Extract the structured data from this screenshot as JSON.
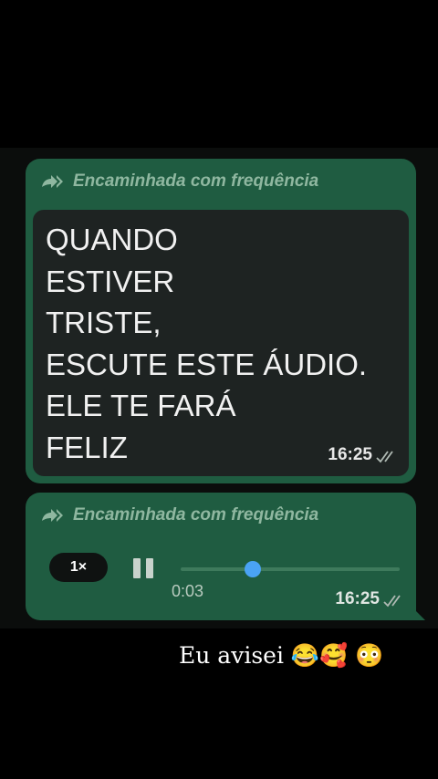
{
  "message_image": {
    "forwarded_label": "Encaminhada com frequência",
    "text_lines": [
      "QUANDO",
      "ESTIVER",
      "TRISTE,",
      "ESCUTE ESTE ÁUDIO.",
      "ELE TE FARÁ",
      "FELIZ"
    ],
    "time": "16:25"
  },
  "message_audio": {
    "forwarded_label": "Encaminhada com frequência",
    "speed": "1×",
    "duration": "0:03",
    "progress": 0.33,
    "time": "16:25"
  },
  "caption": "Eu avisei 😂🥰 😳",
  "colors": {
    "bubble": "#1f5c41",
    "progress_knob": "#4aa3f4",
    "read_ticks": "#9fb2a7"
  }
}
